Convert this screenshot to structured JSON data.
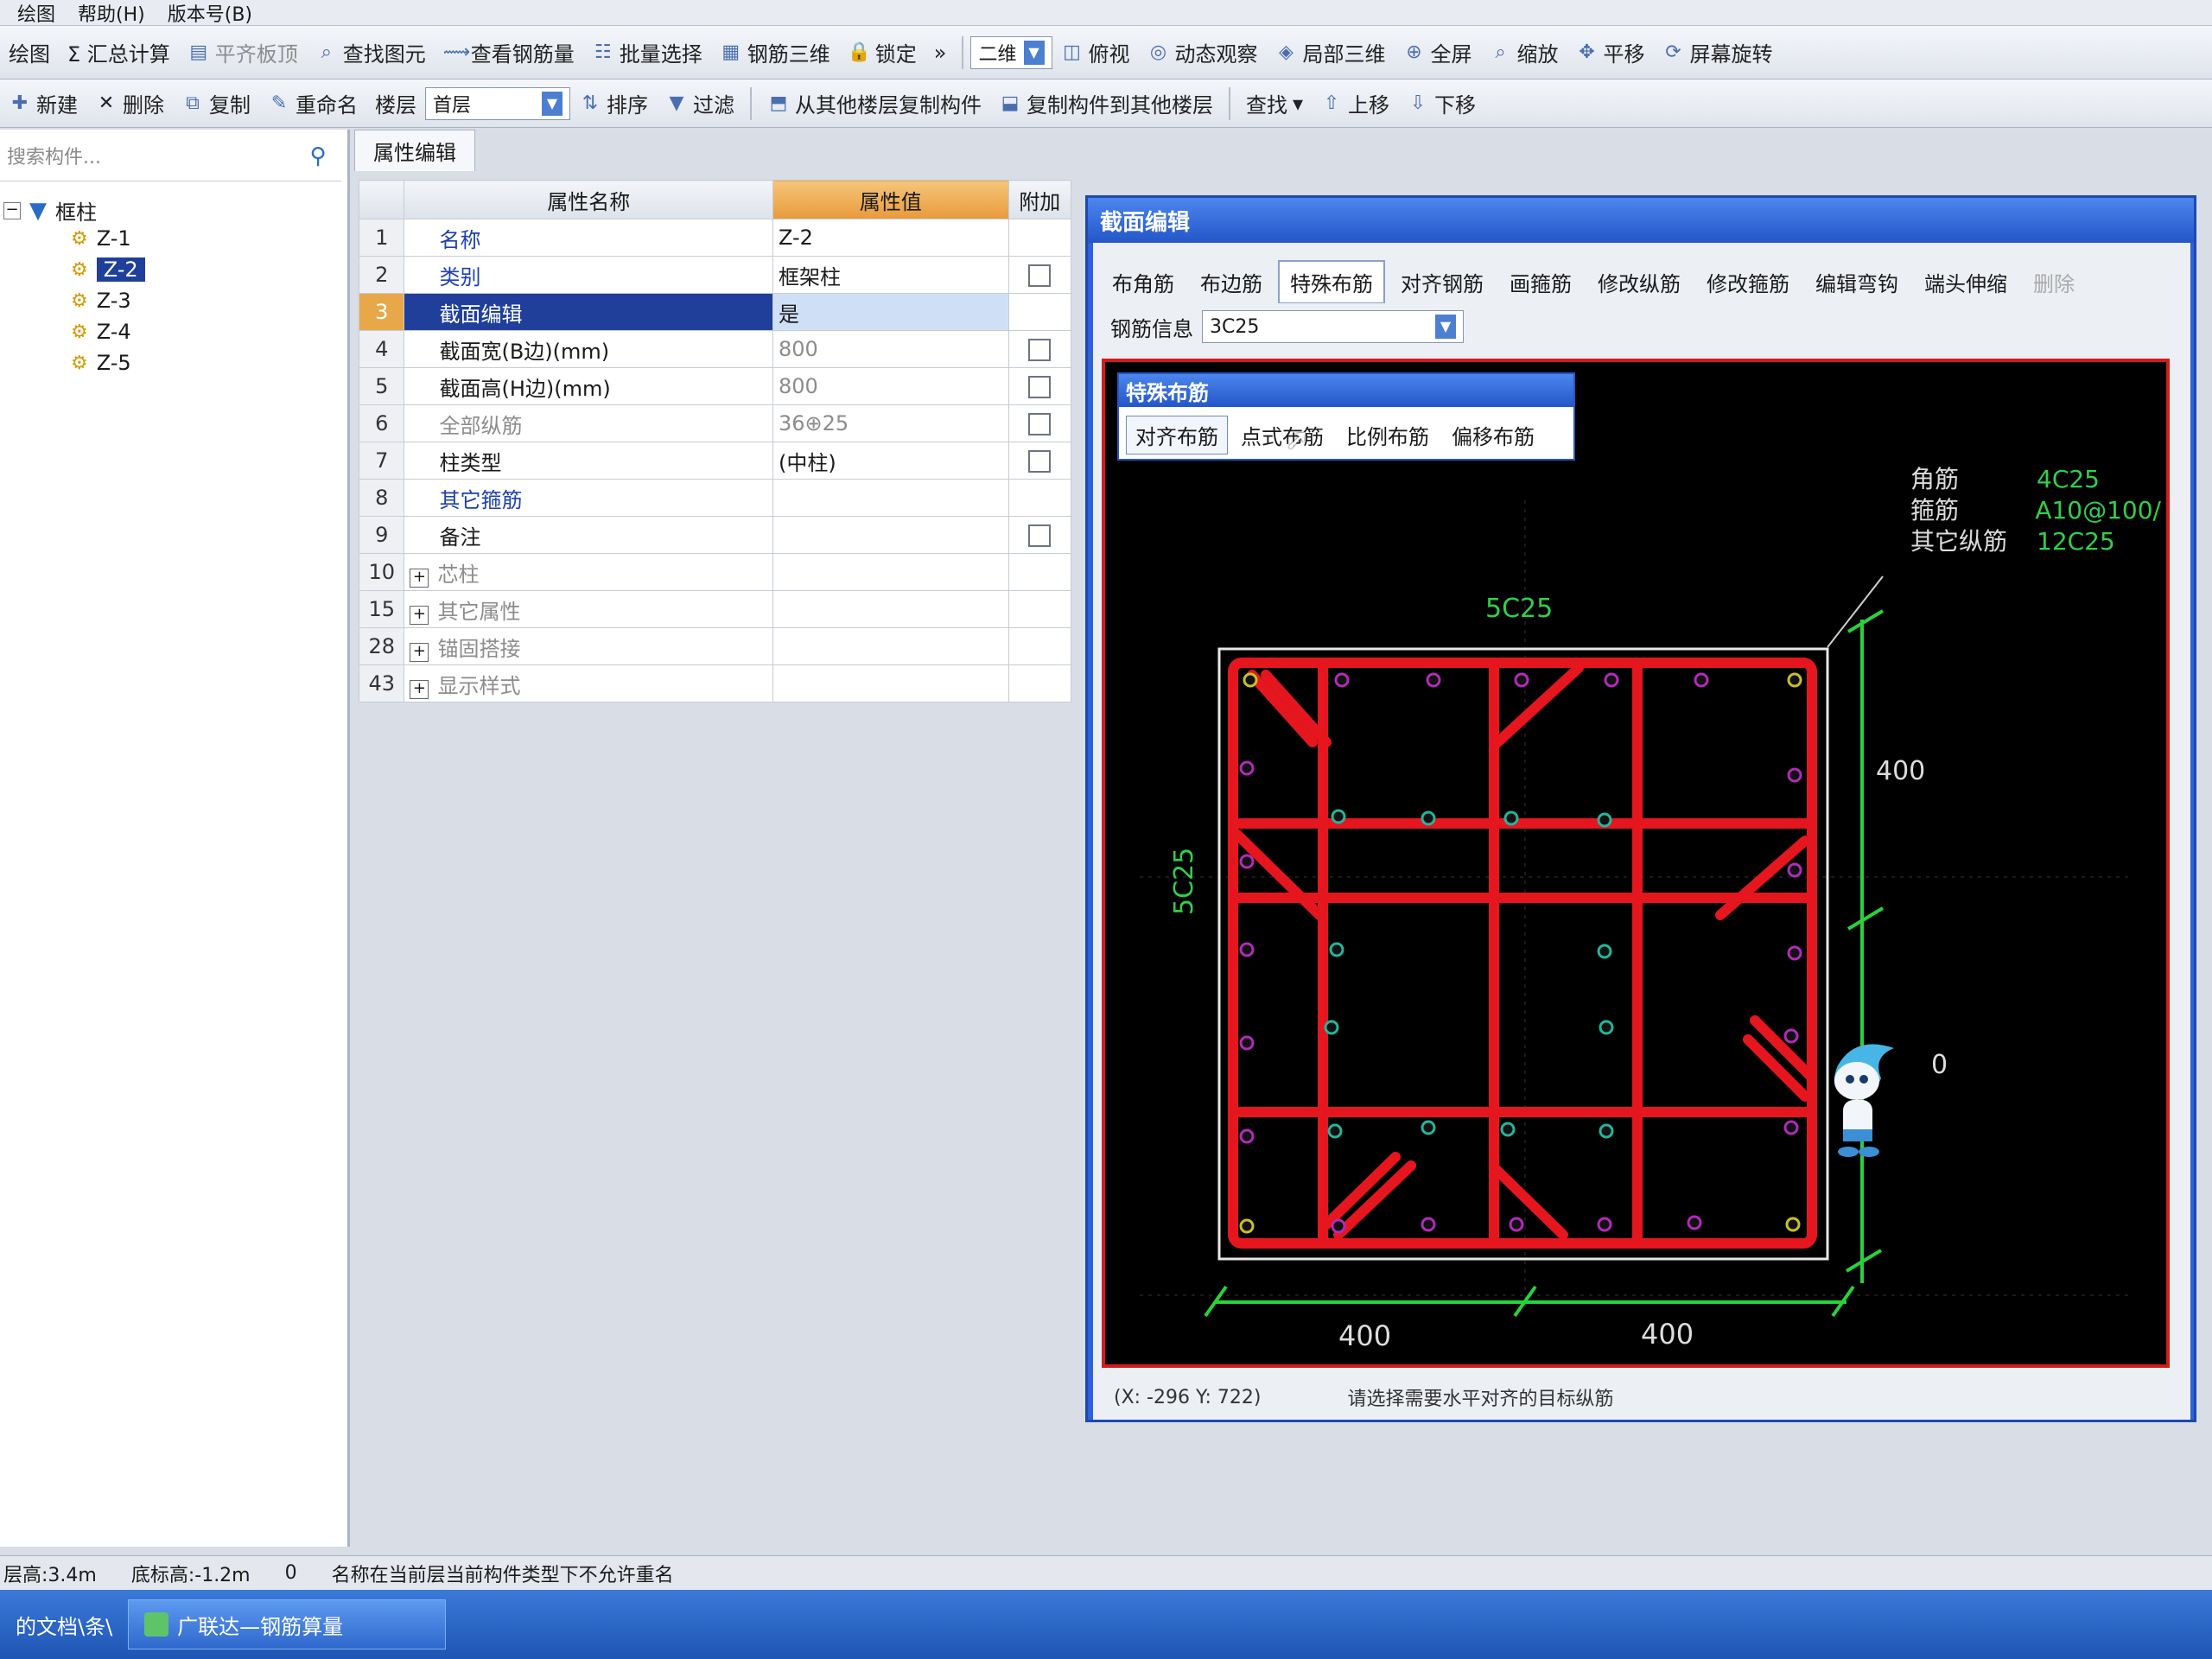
{
  "menu": [
    "绘图",
    "汇总计算",
    "平齐板顶",
    "查找图元",
    "查看钢筋量",
    "批量选择",
    "钢筋三维",
    "锁定",
    "帮助(H)",
    "版本号(B)"
  ],
  "toolbar1": {
    "items": [
      "绘图",
      "Σ 汇总计算",
      "平齐板顶",
      "查找图元",
      "查看钢筋量",
      "批量选择",
      "钢筋三维",
      "锁定"
    ],
    "view_mode": "二维",
    "right_items": [
      "俯视",
      "动态观察",
      "局部三维",
      "全屏",
      "缩放",
      "平移",
      "屏幕旋转"
    ]
  },
  "toolbar2": {
    "items": [
      "新建",
      "删除",
      "复制",
      "重命名"
    ],
    "floor_label": "楼层",
    "floor_value": "首层",
    "sort": "排序",
    "filter": "过滤",
    "copy_from": "从其他楼层复制构件",
    "copy_to": "复制构件到其他楼层",
    "find": "查找",
    "up": "上移",
    "down": "下移"
  },
  "tree": {
    "search_placeholder": "搜索构件...",
    "root": "框柱",
    "items": [
      "Z-1",
      "Z-2",
      "Z-3",
      "Z-4",
      "Z-5"
    ]
  },
  "props": {
    "tab": "属性编辑",
    "headers": {
      "name": "属性名称",
      "value": "属性值",
      "extra": "附加"
    },
    "rows": [
      {
        "no": "1",
        "name": "名称",
        "value": "Z-2"
      },
      {
        "no": "2",
        "name": "类别",
        "value": "框架柱"
      },
      {
        "no": "3",
        "name": "截面编辑",
        "value": "是"
      },
      {
        "no": "4",
        "name": "截面宽(B边)(mm)",
        "value": "800"
      },
      {
        "no": "5",
        "name": "截面高(H边)(mm)",
        "value": "800"
      },
      {
        "no": "6",
        "name": "全部纵筋",
        "value": "36⊕25"
      },
      {
        "no": "7",
        "name": "柱类型",
        "value": "(中柱)"
      },
      {
        "no": "8",
        "name": "其它箍筋",
        "value": ""
      },
      {
        "no": "9",
        "name": "备注",
        "value": ""
      },
      {
        "no": "10",
        "name": "芯柱",
        "value": ""
      },
      {
        "no": "15",
        "name": "其它属性",
        "value": ""
      },
      {
        "no": "28",
        "name": "锚固搭接",
        "value": ""
      },
      {
        "no": "43",
        "name": "显示样式",
        "value": ""
      }
    ]
  },
  "section_editor": {
    "title": "截面编辑",
    "tabs": [
      "布角筋",
      "布边筋",
      "特殊布筋",
      "对齐钢筋",
      "画箍筋",
      "修改纵筋",
      "修改箍筋",
      "编辑弯钩",
      "端头伸缩",
      "删除"
    ],
    "rebar_info_label": "钢筋信息",
    "rebar_info_value": "3C25",
    "special_title": "特殊布筋",
    "special_buttons": [
      "对齐布筋",
      "点式布筋",
      "比例布筋",
      "偏移布筋"
    ],
    "legend": [
      {
        "label": "角筋",
        "value": "4C25"
      },
      {
        "label": "箍筋",
        "value": "A10@100/"
      },
      {
        "label": "其它纵筋",
        "value": "12C25"
      }
    ],
    "top_label": "5C25",
    "left_label": "5C25",
    "dim_right_top": "400",
    "dim_right_mid": "0",
    "dim_bottom_left": "400",
    "dim_bottom_right": "400",
    "coords": "(X: -296 Y: 722)",
    "hint": "请选择需要水平对齐的目标纵筋"
  },
  "status": {
    "floor_height": "层高:3.4m",
    "base_height": "底标高:-1.2m",
    "zero": "0",
    "message": "名称在当前层当前构件类型下不允许重名"
  },
  "taskbar": {
    "left": "的文档\\条\\",
    "app": "广联达—钢筋算量"
  },
  "colors": {
    "rebar": "#e5161e",
    "dim": "#27d23a",
    "legend": "#2fd04a",
    "canvas": "#000000"
  }
}
